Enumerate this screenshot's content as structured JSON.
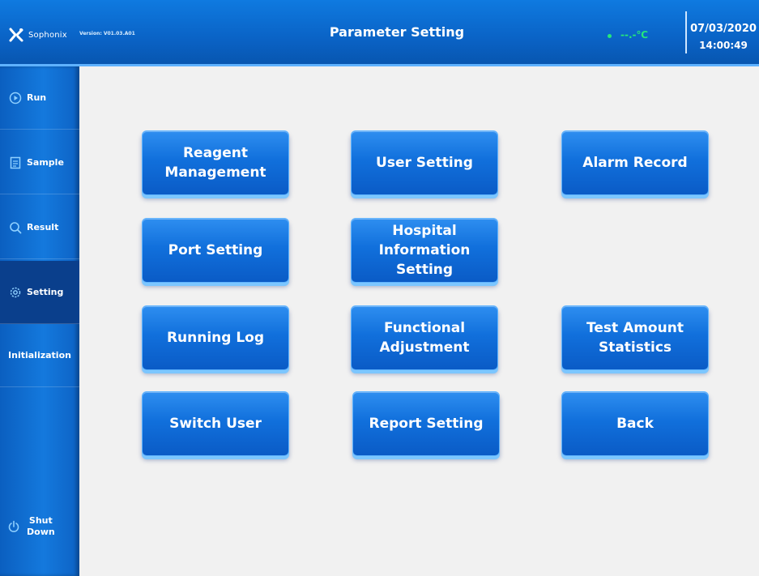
{
  "header": {
    "brand": "Sophonix",
    "version": "Version: V01.03.A01",
    "title": "Parameter Setting",
    "temperature": "--.-℃",
    "date": "07/03/2020",
    "time": "14:00:49",
    "status_color": "#25e87a"
  },
  "sidebar": {
    "items": [
      {
        "label": "Run",
        "icon": "play-circle-icon"
      },
      {
        "label": "Sample",
        "icon": "document-icon"
      },
      {
        "label": "Result",
        "icon": "magnifier-icon"
      },
      {
        "label": "Setting",
        "icon": "gear-icon",
        "active": true
      },
      {
        "label": "Initialization"
      }
    ],
    "shutdown": {
      "label_line1": "Shut",
      "label_line2": "Down",
      "icon": "power-icon"
    }
  },
  "buttons": {
    "reagent_management": "Reagent\nManagement",
    "user_setting": "User Setting",
    "alarm_record": "Alarm Record",
    "port_setting": "Port Setting",
    "hospital_information_setting": "Hospital\nInformation\nSetting",
    "running_log": "Running Log",
    "functional_adjustment": "Functional\nAdjustment",
    "test_amount_statistics": "Test Amount\nStatistics",
    "switch_user": "Switch User",
    "report_setting": "Report Setting",
    "back": "Back"
  },
  "colors": {
    "header_blue": "#0a63c6",
    "button_blue": "#1170dc",
    "background": "#f1f1f1"
  }
}
